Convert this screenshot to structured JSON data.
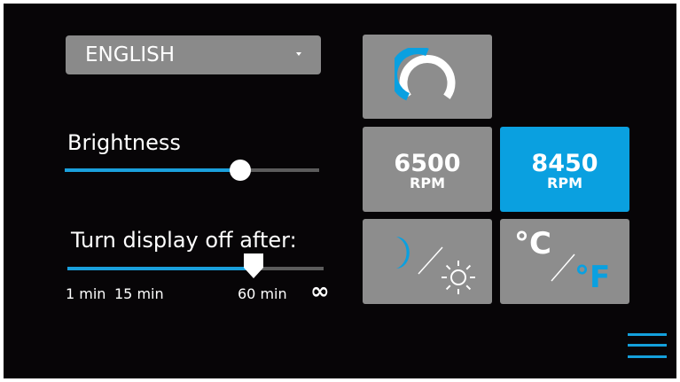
{
  "language": {
    "selected": "ENGLISH"
  },
  "brightness": {
    "label": "Brightness",
    "level_fraction": 0.69
  },
  "display_off": {
    "label": "Turn display off after:",
    "ticks": [
      "1 min",
      "15 min",
      "60 min",
      "∞"
    ],
    "selected": "60 min"
  },
  "fan_modes": [
    {
      "value": "6500",
      "unit": "RPM",
      "active": false
    },
    {
      "value": "8450",
      "unit": "RPM",
      "active": true
    }
  ],
  "temperature_units": {
    "celsius": "°C",
    "fahrenheit": "°F"
  },
  "colors": {
    "background": "#070507",
    "tile": "#8d8d8d",
    "accent": "#0aa0e0",
    "track": "#5c5c5c"
  },
  "icons": {
    "gauge": "gauge-icon",
    "day_night": "moon-sun-icon",
    "temperature": "celsius-fahrenheit-icon",
    "menu": "hamburger-menu-icon"
  }
}
